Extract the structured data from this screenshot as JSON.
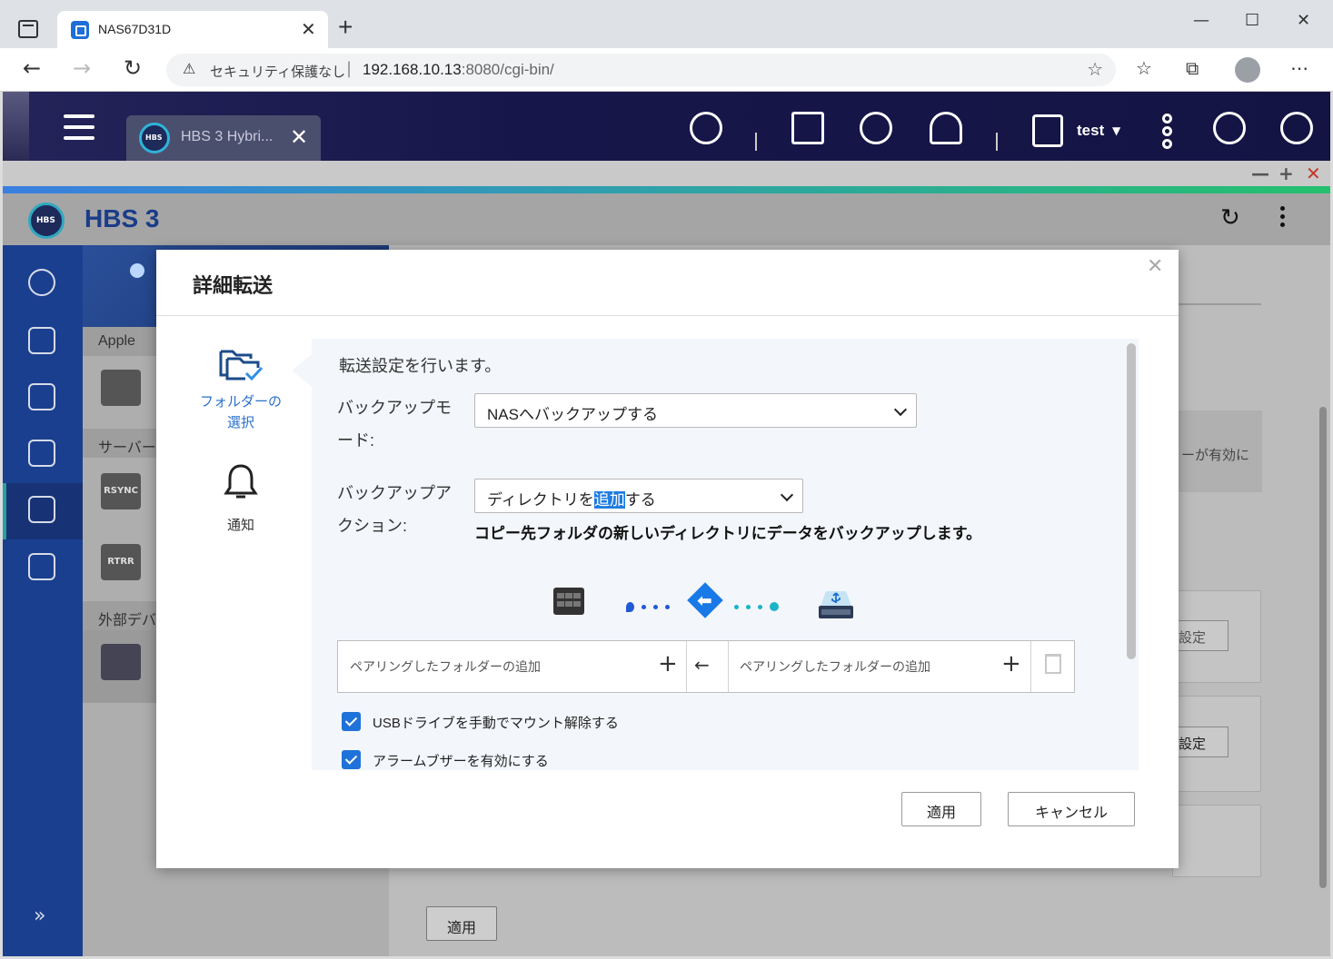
{
  "browser": {
    "tab_title": "NAS67D31D",
    "insecure_label": "セキュリティ保護なし",
    "url_host": "192.168.10.13",
    "url_rest": ":8080/cgi-bin/"
  },
  "qts": {
    "app_tab_label": "HBS 3 Hybri...",
    "user_name": "test"
  },
  "hbs": {
    "title": "HBS 3",
    "sections": {
      "apple": "Apple",
      "server": "サーバー",
      "external": "外部デバ"
    },
    "items": {
      "rsync": "RSYNC",
      "rtrr": "RTRR"
    },
    "right_note": "ーが有効に",
    "right_btn_1": "設定",
    "right_btn_2": "設定",
    "apply_label": "適用"
  },
  "modal": {
    "title": "詳細転送",
    "steps": [
      {
        "label_line1": "フォルダーの",
        "label_line2": "選択"
      },
      {
        "label_line1": "通知"
      }
    ],
    "intro": "転送設定を行います。",
    "backup_mode_label_1": "バックアップモ",
    "backup_mode_label_2": "ード:",
    "backup_mode_value": "NASへバックアップする",
    "backup_action_label_1": "バックアップア",
    "backup_action_label_2": "クション:",
    "backup_action_value_pre": "ディレクトリを",
    "backup_action_value_hl": "追加",
    "backup_action_value_post": "する",
    "action_description": "コピー先フォルダの新しいディレクトリにデータをバックアップします。",
    "pair_placeholder_left": "ペアリングしたフォルダーの追加",
    "pair_placeholder_right": "ペアリングしたフォルダーの追加",
    "check_unmount": "USBドライブを手動でマウント解除する",
    "check_buzzer": "アラームブザーを有効にする",
    "apply_button": "適用",
    "cancel_button": "キャンセル"
  },
  "colors": {
    "accent_blue": "#1f72d9",
    "qts_bar": "#16164a",
    "sidebar": "#1b3f8f",
    "flow_start": "#2159d6",
    "flow_end": "#1cb3c8"
  }
}
